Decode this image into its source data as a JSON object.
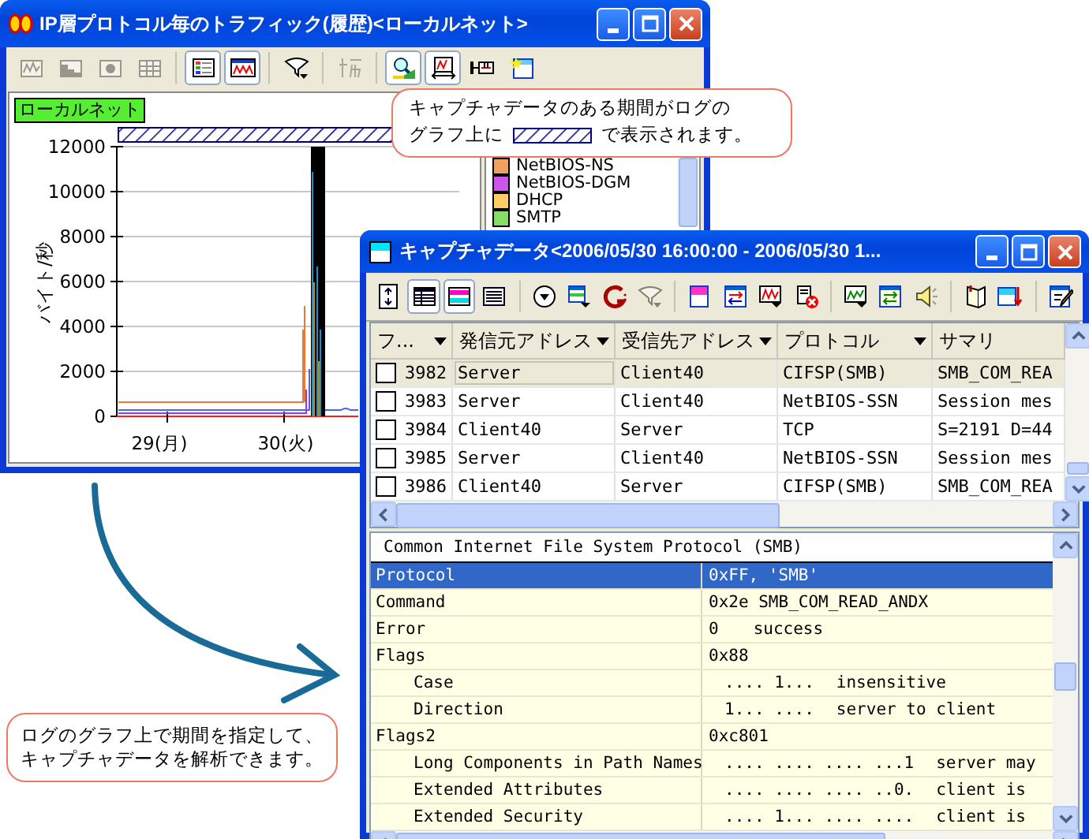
{
  "window_main": {
    "title": "IP層プロトコル毎のトラフィック(履歴)<ローカルネット>",
    "toolbar": [
      {
        "kind": "line-chart",
        "pressed": false,
        "disabled": true,
        "separator_before": false
      },
      {
        "kind": "area-chart",
        "pressed": false,
        "disabled": true,
        "separator_before": false
      },
      {
        "kind": "record",
        "pressed": false,
        "disabled": true,
        "separator_before": false
      },
      {
        "kind": "grid",
        "pressed": false,
        "disabled": true,
        "separator_before": false
      },
      {
        "kind": "legend-list",
        "pressed": true,
        "disabled": false,
        "separator_before": true
      },
      {
        "kind": "chart-window",
        "pressed": true,
        "disabled": false,
        "separator_before": false
      },
      {
        "kind": "funnel",
        "pressed": false,
        "disabled": false,
        "separator_before": true
      },
      {
        "kind": "expand",
        "pressed": false,
        "disabled": true,
        "separator_before": true
      },
      {
        "kind": "magnifier-chart",
        "pressed": true,
        "disabled": false,
        "separator_before": true
      },
      {
        "kind": "graph-fit",
        "pressed": true,
        "disabled": false,
        "separator_before": false
      },
      {
        "kind": "ruler",
        "pressed": false,
        "disabled": false,
        "separator_before": false
      },
      {
        "kind": "new-window",
        "pressed": false,
        "disabled": false,
        "separator_before": false
      }
    ],
    "series_label": "ローカルネット",
    "y_label": "バイト/秒",
    "y_ticks": [
      "12000",
      "10000",
      "8000",
      "6000",
      "4000",
      "2000",
      "0"
    ],
    "x_ticks": [
      "29(月)",
      "30(火)"
    ],
    "legend": [
      {
        "label": "NetBIOS-NS",
        "color": "#f0a060"
      },
      {
        "label": "NetBIOS-DGM",
        "color": "#cc55ee"
      },
      {
        "label": "DHCP",
        "color": "#ffcc66"
      },
      {
        "label": "SMTP",
        "color": "#88dd66"
      }
    ]
  },
  "callout_top": {
    "line_1": "キャプチャデータのある期間がログの",
    "line_2_start": "グラフ上に",
    "line_2_end": "で表示されます。"
  },
  "window_capture": {
    "title": "キャプチャデータ<2006/05/30 16:00:00 - 2006/05/30 1...",
    "toolbar": [
      {
        "kind": "fit-height",
        "pressed": false,
        "disabled": false,
        "separator_before": false
      },
      {
        "kind": "table-grid",
        "pressed": true,
        "disabled": false,
        "separator_before": false
      },
      {
        "kind": "color-rows",
        "pressed": true,
        "disabled": false,
        "separator_before": false
      },
      {
        "kind": "list",
        "pressed": false,
        "disabled": false,
        "separator_before": false
      },
      {
        "kind": "circle-dropdown",
        "pressed": false,
        "disabled": false,
        "separator_before": true
      },
      {
        "kind": "filter-down",
        "pressed": false,
        "disabled": false,
        "separator_before": false
      },
      {
        "kind": "g-arc",
        "pressed": false,
        "disabled": false,
        "separator_before": false
      },
      {
        "kind": "funnel",
        "pressed": false,
        "disabled": true,
        "separator_before": false
      },
      {
        "kind": "highlight-window",
        "pressed": false,
        "disabled": false,
        "separator_before": true
      },
      {
        "kind": "swap-window",
        "pressed": false,
        "disabled": false,
        "separator_before": false
      },
      {
        "kind": "wave-window",
        "pressed": false,
        "disabled": false,
        "separator_before": false
      },
      {
        "kind": "delete-doc",
        "pressed": false,
        "disabled": false,
        "separator_before": false
      },
      {
        "kind": "chart-down",
        "pressed": false,
        "disabled": false,
        "separator_before": true
      },
      {
        "kind": "swap-arrows",
        "pressed": false,
        "disabled": false,
        "separator_before": false
      },
      {
        "kind": "speaker",
        "pressed": false,
        "disabled": false,
        "separator_before": false
      },
      {
        "kind": "book",
        "pressed": false,
        "disabled": false,
        "separator_before": true
      },
      {
        "kind": "window-down",
        "pressed": false,
        "disabled": false,
        "separator_before": false
      },
      {
        "kind": "edit-doc",
        "pressed": false,
        "disabled": false,
        "separator_before": true
      }
    ],
    "columns": [
      {
        "label": "フ...",
        "dropdown": true
      },
      {
        "label": "発信元アドレス",
        "dropdown": true
      },
      {
        "label": "受信先アドレス",
        "dropdown": true
      },
      {
        "label": "プロトコル",
        "dropdown": true
      },
      {
        "label": "サマリ",
        "dropdown": false
      }
    ],
    "rows": [
      {
        "checked": false,
        "selected": true,
        "frame": "3982",
        "source": "Server",
        "destination": "Client40",
        "protocol": "CIFSP(SMB)",
        "summary": "SMB_COM_REA"
      },
      {
        "checked": false,
        "selected": false,
        "frame": "3983",
        "source": "Server",
        "destination": "Client40",
        "protocol": "NetBIOS-SSN",
        "summary": "Session mes"
      },
      {
        "checked": false,
        "selected": false,
        "frame": "3984",
        "source": "Client40",
        "destination": "Server",
        "protocol": "TCP",
        "summary": "S=2191 D=44"
      },
      {
        "checked": false,
        "selected": false,
        "frame": "3985",
        "source": "Server",
        "destination": "Client40",
        "protocol": "NetBIOS-SSN",
        "summary": "Session mes"
      },
      {
        "checked": false,
        "selected": false,
        "frame": "3986",
        "source": "Client40",
        "destination": "Server",
        "protocol": "CIFSP(SMB)",
        "summary": "SMB_COM_REA"
      }
    ],
    "detail": {
      "header": "Common Internet File System Protocol (SMB)",
      "fields": [
        {
          "name": "Protocol",
          "value": "0xFF, 'SMB'",
          "selected": true
        },
        {
          "name": "Command",
          "value": "0x2e SMB_COM_READ_ANDX",
          "selected": false
        },
        {
          "name": "Error",
          "value": "0",
          "meaning": "success",
          "selected": false
        },
        {
          "name": "Flags",
          "value": "0x88",
          "selected": false,
          "children": [
            {
              "name": "Case",
              "bits": ".... 1...",
              "meaning": "insensitive",
              "selected": false
            },
            {
              "name": "Direction",
              "bits": "1... ....",
              "meaning": "server to client",
              "selected": false
            }
          ]
        },
        {
          "name": "Flags2",
          "value": "0xc801",
          "selected": false,
          "children": [
            {
              "name": "Long Components in Path Names",
              "bits": ".... .... .... ...1",
              "meaning": "server may",
              "selected": false
            },
            {
              "name": "Extended Attributes",
              "bits": ".... .... .... ..0.",
              "meaning": "client is",
              "selected": false
            },
            {
              "name": "Extended Security",
              "bits": ".... 1... .... ....",
              "meaning": "client is",
              "selected": false
            }
          ]
        }
      ]
    }
  },
  "callout_bottom": {
    "lines": [
      "ログのグラフ上で期間を指定して、",
      "キャプチャデータを解析できます。"
    ]
  }
}
